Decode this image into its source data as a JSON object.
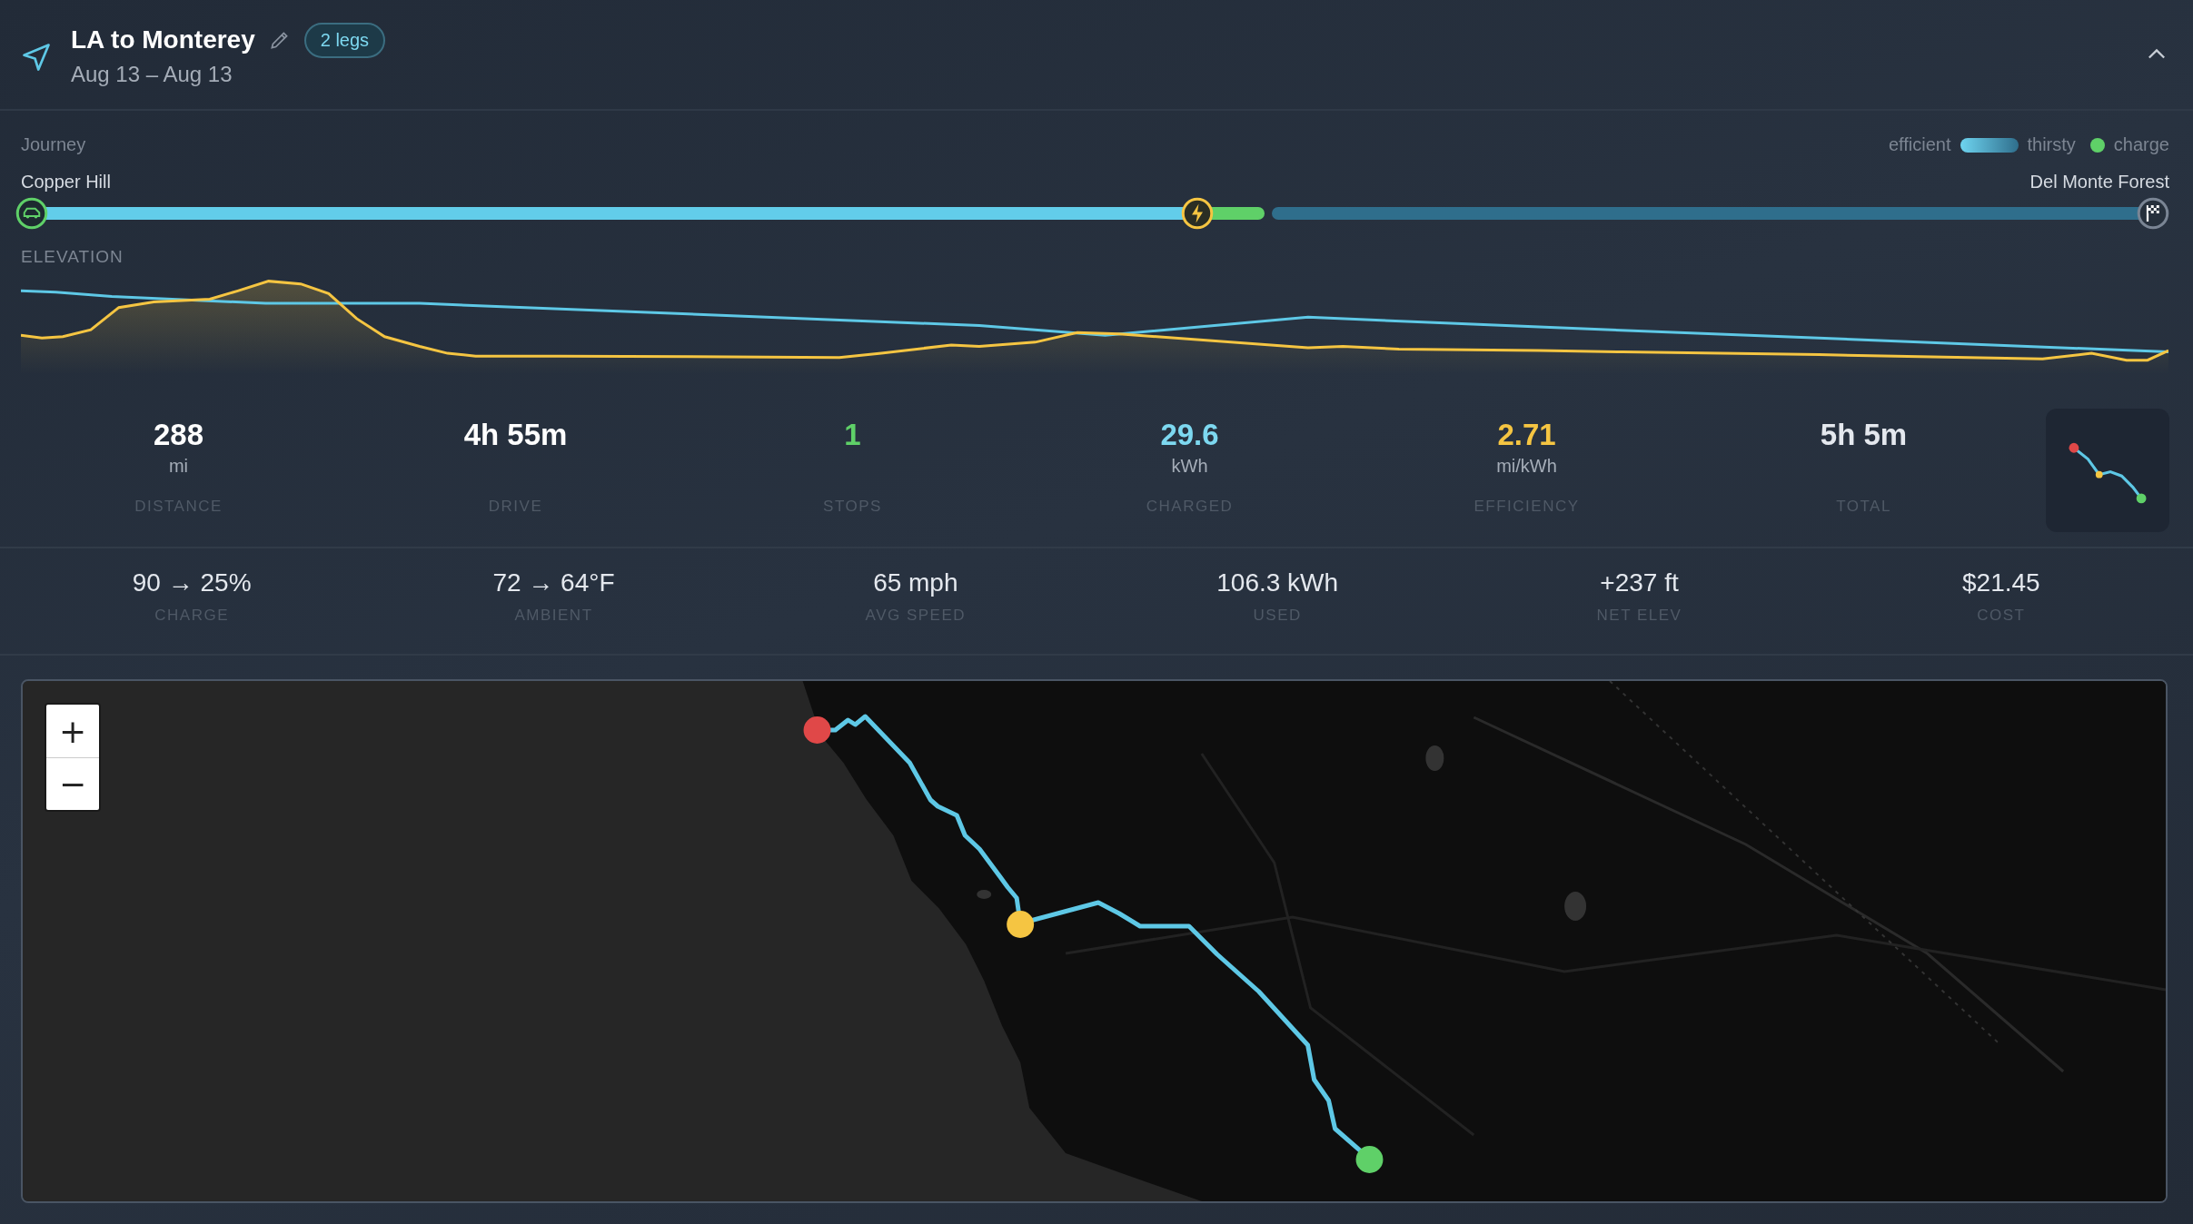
{
  "header": {
    "title": "LA to Monterey",
    "badge": "2 legs",
    "dates": "Aug 13 – Aug 13",
    "expanded": true
  },
  "journey": {
    "label": "Journey",
    "start": "Copper Hill",
    "end": "Del Monte Forest",
    "legend": {
      "low": "efficient",
      "high": "thirsty",
      "dot": "charge"
    },
    "segments": [
      {
        "kind": "efficient"
      },
      {
        "kind": "charge"
      },
      {
        "kind": "thirsty"
      }
    ]
  },
  "elevation": {
    "label": "ELEVATION"
  },
  "stats": [
    {
      "value": "288",
      "unit": "mi",
      "label": "DISTANCE",
      "color": "#ffffff"
    },
    {
      "value": "4h 55m",
      "label": "DRIVE",
      "color": "#ffffff"
    },
    {
      "value": "1",
      "label": "STOPS",
      "color": "#5fd068"
    },
    {
      "value": "29.6",
      "unit": "kWh",
      "label": "CHARGED",
      "color": "#7dd8f0"
    },
    {
      "value": "2.71",
      "unit": "mi/kWh",
      "label": "EFFICIENCY",
      "color": "#f5c542"
    },
    {
      "value": "5h 5m",
      "label": "TOTAL",
      "color": "#e4e8ee"
    }
  ],
  "details": [
    {
      "value": "90 → 25%",
      "label": "CHARGE"
    },
    {
      "value": "72 → 64°F",
      "label": "AMBIENT"
    },
    {
      "value": "65 mph",
      "label": "AVG SPEED"
    },
    {
      "value": "106.3 kWh",
      "label": "USED"
    },
    {
      "value": "+237 ft",
      "label": "NET ELEV"
    },
    {
      "value": "$21.45",
      "label": "COST"
    }
  ],
  "map": {
    "zoom_in": "+",
    "zoom_out": "−",
    "stops": [
      {
        "color": "#e04848"
      },
      {
        "color": "#f5c542"
      },
      {
        "color": "#5fd068"
      }
    ]
  }
}
